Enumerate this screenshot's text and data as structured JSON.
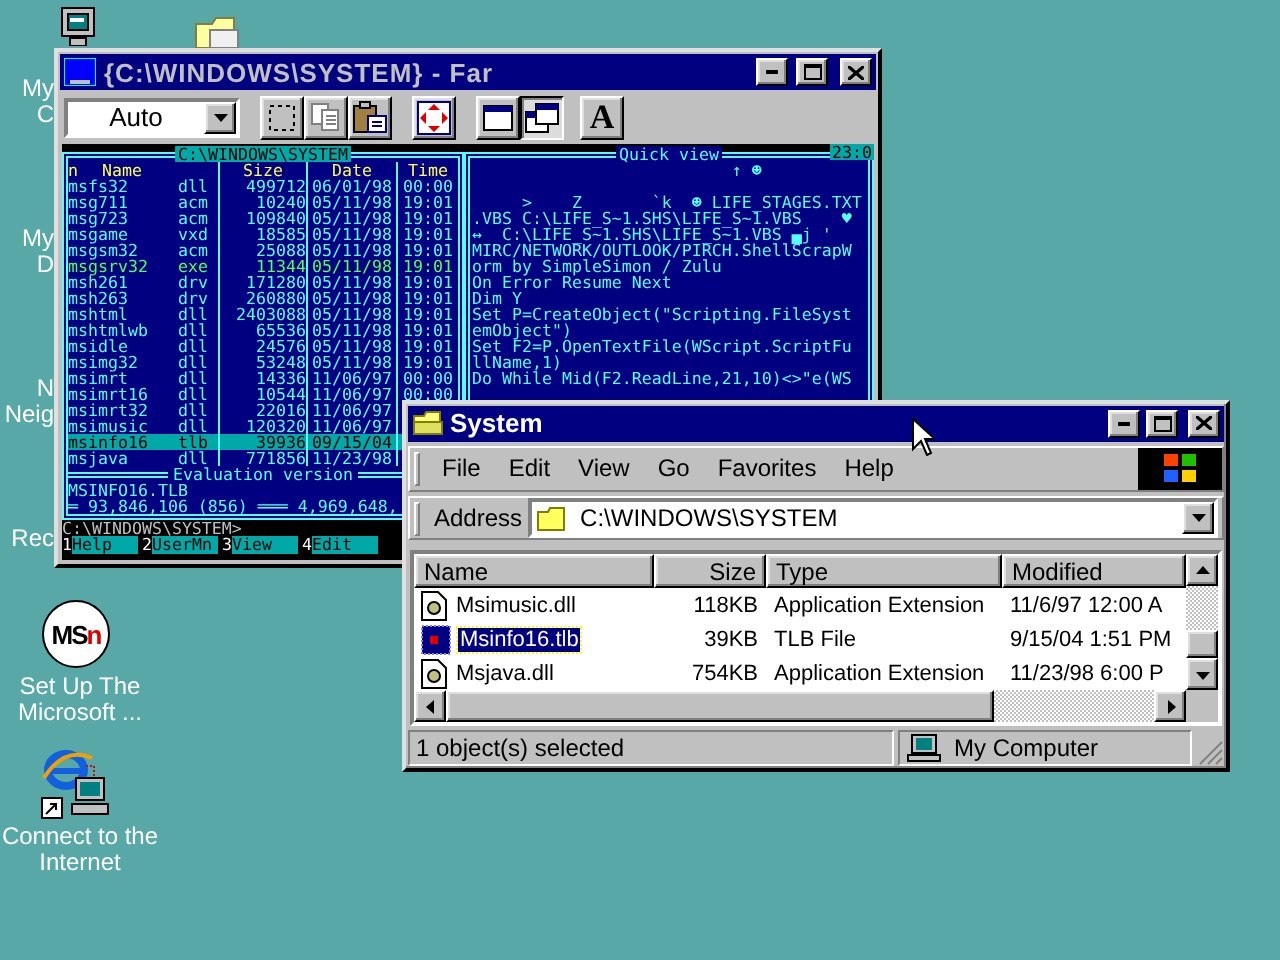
{
  "desktop": {
    "icons": [
      {
        "label": "My C",
        "kind": "partial"
      },
      {
        "label": "My D",
        "kind": "partial"
      },
      {
        "label": "N Neig",
        "kind": "partial"
      },
      {
        "label": "Rec",
        "kind": "partial"
      },
      {
        "label": "Set Up The Microsoft ...",
        "kind": "msn",
        "logo": [
          "MS",
          "n"
        ]
      },
      {
        "label": "Connect to the Internet",
        "kind": "connect"
      }
    ]
  },
  "far": {
    "title": "{C:\\WINDOWS\\SYSTEM} - Far",
    "font_size": "Auto",
    "font_button": "A",
    "left_panel": {
      "path": "C:\\WINDOWS\\SYSTEM",
      "columns": [
        "n",
        "Name",
        "Size",
        "Date",
        "Time"
      ],
      "rows": [
        {
          "name": "msfs32",
          "ext": "dll",
          "size": "499712",
          "date": "06/01/98",
          "time": "00:00",
          "kind": "file",
          "selected": false
        },
        {
          "name": "msg711",
          "ext": "acm",
          "size": "10240",
          "date": "05/11/98",
          "time": "19:01",
          "kind": "file",
          "selected": false
        },
        {
          "name": "msg723",
          "ext": "acm",
          "size": "109840",
          "date": "05/11/98",
          "time": "19:01",
          "kind": "file",
          "selected": false
        },
        {
          "name": "msgame",
          "ext": "vxd",
          "size": "18585",
          "date": "05/11/98",
          "time": "19:01",
          "kind": "file",
          "selected": false
        },
        {
          "name": "msgsm32",
          "ext": "acm",
          "size": "25088",
          "date": "05/11/98",
          "time": "19:01",
          "kind": "file",
          "selected": false
        },
        {
          "name": "msgsrv32",
          "ext": "exe",
          "size": "11344",
          "date": "05/11/98",
          "time": "19:01",
          "kind": "executable",
          "selected": false
        },
        {
          "name": "msh261",
          "ext": "drv",
          "size": "171280",
          "date": "05/11/98",
          "time": "19:01",
          "kind": "file",
          "selected": false
        },
        {
          "name": "msh263",
          "ext": "drv",
          "size": "260880",
          "date": "05/11/98",
          "time": "19:01",
          "kind": "file",
          "selected": false
        },
        {
          "name": "mshtml",
          "ext": "dll",
          "size": "2403088",
          "date": "05/11/98",
          "time": "19:01",
          "kind": "file",
          "selected": false
        },
        {
          "name": "mshtmlwb",
          "ext": "dll",
          "size": "65536",
          "date": "05/11/98",
          "time": "19:01",
          "kind": "file",
          "selected": false
        },
        {
          "name": "msidle",
          "ext": "dll",
          "size": "24576",
          "date": "05/11/98",
          "time": "19:01",
          "kind": "file",
          "selected": false
        },
        {
          "name": "msimg32",
          "ext": "dll",
          "size": "53248",
          "date": "05/11/98",
          "time": "19:01",
          "kind": "file",
          "selected": false
        },
        {
          "name": "msimrt",
          "ext": "dll",
          "size": "14336",
          "date": "11/06/97",
          "time": "00:00",
          "kind": "file",
          "selected": false
        },
        {
          "name": "msimrt16",
          "ext": "dll",
          "size": "10544",
          "date": "11/06/97",
          "time": "00:00",
          "kind": "file",
          "selected": false
        },
        {
          "name": "msimrt32",
          "ext": "dll",
          "size": "22016",
          "date": "11/06/97",
          "kind": "file",
          "selected": false
        },
        {
          "name": "msimusic",
          "ext": "dll",
          "size": "120320",
          "date": "11/06/97",
          "kind": "file",
          "selected": false
        },
        {
          "name": "msinfo16",
          "ext": "tlb",
          "size": "39936",
          "date": "09/15/04",
          "kind": "file",
          "selected": true
        },
        {
          "name": "msjava",
          "ext": "dll",
          "size": "771856",
          "date": "11/23/98",
          "kind": "file",
          "selected": false
        }
      ],
      "footer": "Evaluation version",
      "current_file": "MSINFO16.TLB",
      "totals": "═ 93,846,106 (856) ═══ 4,969,648,"
    },
    "right_panel": {
      "title": "Quick view",
      "lines": [
        "                          ↑ ☻",
        "     >    Z       `k  ☻ LIFE_STAGES.TXT",
        ".VBS C:\\LIFE_S~1.SHS\\LIFE_S~1.VBS    ♥",
        "↔  C:\\LIFE_S~1.SHS\\LIFE_S~1.VBS ▄j '",
        "MIRC/NETWORK/OUTLOOK/PIRCH.ShellScrapW",
        "orm by SimpleSimon / Zulu",
        "On Error Resume Next",
        "Dim Y",
        "Set P=CreateObject(\"Scripting.FileSyst",
        "emObject\")",
        "Set F2=P.OpenTextFile(WScript.ScriptFu",
        "llName,1)",
        "Do While Mid(F2.ReadLine,21,10)<>\"e(WS"
      ]
    },
    "clock": "23:0",
    "command_line": "C:\\WINDOWS\\SYSTEM>",
    "keys": [
      {
        "number": "1",
        "label": "Help"
      },
      {
        "number": "2",
        "label": "UserMn"
      },
      {
        "number": "3",
        "label": "View"
      },
      {
        "number": "4",
        "label": "Edit"
      }
    ]
  },
  "explorer": {
    "title": "System",
    "menu": [
      "File",
      "Edit",
      "View",
      "Go",
      "Favorites",
      "Help"
    ],
    "address_label": "Address",
    "address": "C:\\WINDOWS\\SYSTEM",
    "columns": [
      "Name",
      "Size",
      "Type",
      "Modified"
    ],
    "rows": [
      {
        "name": "Msimusic.dll",
        "size": "118KB",
        "type": "Application Extension",
        "modified": "11/6/97 12:00 A",
        "kind": "dll",
        "selected": false
      },
      {
        "name": "Msinfo16.tlb",
        "size": "39KB",
        "type": "TLB File",
        "modified": "9/15/04 1:51 PM",
        "kind": "tlb",
        "selected": true
      },
      {
        "name": "Msjava.dll",
        "size": "754KB",
        "type": "Application Extension",
        "modified": "11/23/98 6:00 P",
        "kind": "dll",
        "selected": false
      }
    ],
    "status": "1 object(s) selected",
    "zone": "My Computer"
  }
}
